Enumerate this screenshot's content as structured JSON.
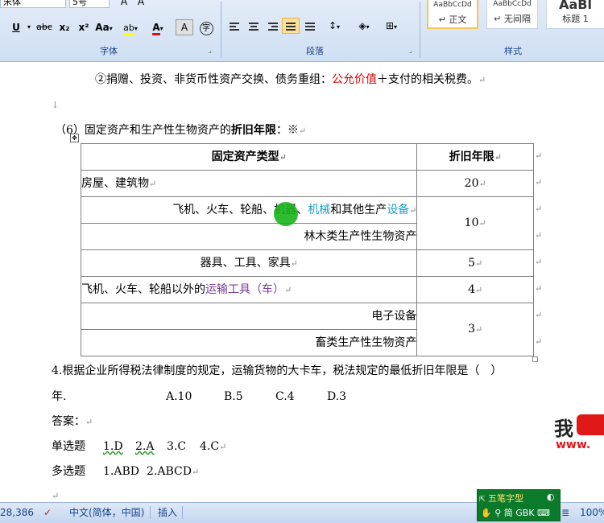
{
  "ribbon": {
    "font_group": {
      "label": "字体",
      "font_name": "宋体",
      "font_size": "5号",
      "buttons": [
        "U",
        "abc",
        "x₂",
        "x²",
        "Aa",
        "ab",
        "A",
        "A",
        "字"
      ]
    },
    "paragraph_group": {
      "label": "段落"
    },
    "styles_group": {
      "label": "样式",
      "styles": [
        {
          "preview": "AaBbCcDd",
          "name": "↵ 正文",
          "selected": true
        },
        {
          "preview": "AaBbCcDd",
          "name": "↵ 无间隔",
          "selected": false
        },
        {
          "preview": "AaBl",
          "name": "标题 1",
          "selected": false
        }
      ]
    }
  },
  "document": {
    "line1": {
      "prefix": "②捐赠、投资、非货币性资产交换、债务重组：",
      "highlight": "公允价值",
      "suffix": "＋支付的相关税费。"
    },
    "line2_heading": {
      "prefix": "（6）固定资产和生产性生物资产的",
      "bold": "折旧年限",
      "suffix": "：※"
    },
    "table": {
      "header": {
        "col1": "固定资产类型",
        "col2": "折旧年限"
      },
      "rows": [
        {
          "a": "房屋、建筑物",
          "years": "20"
        },
        {
          "a1": "飞机、火车、轮船、机器、",
          "a2": "机械",
          "a3": "和其他生产",
          "a4": "设备",
          "b": "林木类生产性生物资产",
          "years": "10"
        },
        {
          "a": "器具、工具、家具",
          "years": "5"
        },
        {
          "a1": "飞机、火车、轮船以外的",
          "a2": "运输工具（车）",
          "years": "4"
        },
        {
          "a": "电子设备",
          "b": "畜类生产性生物资产",
          "years": "3"
        }
      ]
    },
    "question": {
      "text": "4.根据企业所得税法律制度的规定，运输货物的大卡车，税法规定的最低折旧年限是（　）",
      "line2": "年.",
      "options": [
        "A.10",
        "B.5",
        "C.4",
        "D.3"
      ]
    },
    "answer_label": "答案：",
    "single_choice": {
      "label": "单选题",
      "answers": [
        "1.D",
        "2.A",
        "3.C",
        "4.C"
      ]
    },
    "multiple_choice": {
      "label": "多选题",
      "answers": [
        "1.ABD",
        "2.ABCD"
      ]
    },
    "watermark": {
      "char": "我",
      "fragment": "www."
    }
  },
  "ime": {
    "title": "五笔字型",
    "row2": "简 GBK"
  },
  "status_bar": {
    "word_count": "28,386",
    "language": "中文(简体，中国)",
    "mode": "插入",
    "zoom": "100%"
  }
}
